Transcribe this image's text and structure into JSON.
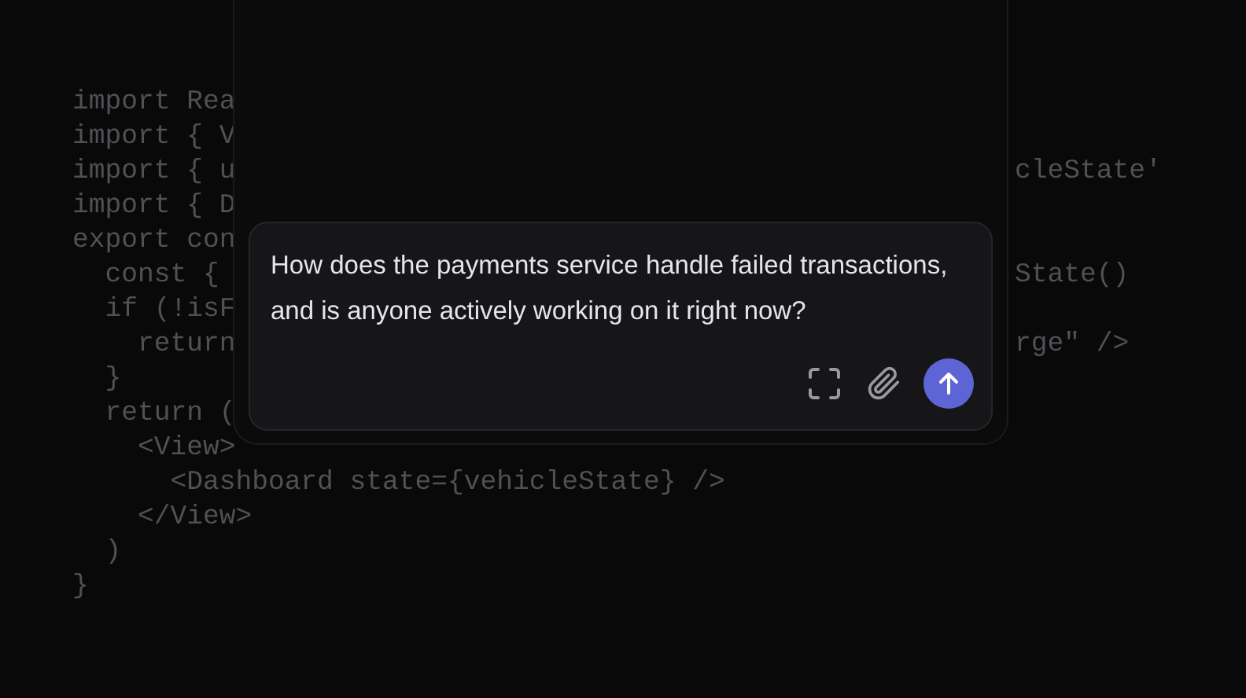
{
  "code_lines": [
    {
      "left": "import Rea"
    },
    {
      "left": "import { V"
    },
    {
      "left": "import { u",
      "right": "cleState'"
    },
    {
      "left": "import { D"
    },
    {
      "left": "export con"
    },
    {
      "left": "  const {",
      "right": "State()"
    },
    {
      "left": "  if (!isF"
    },
    {
      "left": "    return",
      "right": "rge\" />"
    },
    {
      "left": "  }"
    },
    {
      "left": "  return ("
    },
    {
      "left": "    <View>"
    },
    {
      "left": "      <Dashboard state={vehicleState} />"
    },
    {
      "left": "    </View>"
    },
    {
      "left": "  )"
    },
    {
      "left": "}"
    }
  ],
  "composer": {
    "value": "How does the payments service handle failed transactions, and is anyone actively working on it right now?"
  }
}
